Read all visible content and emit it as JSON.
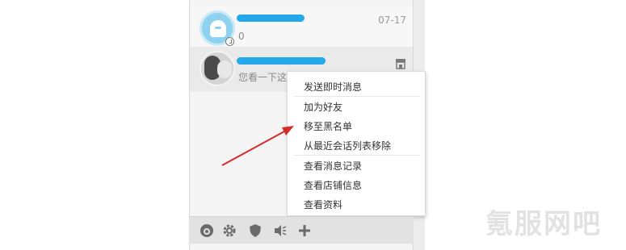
{
  "conversations": [
    {
      "time": "07-17",
      "preview": "0"
    },
    {
      "preview": "您看一下这…"
    }
  ],
  "context_menu": {
    "items": [
      "发送即时消息",
      "加为好友",
      "移至黑名单",
      "从最近会话列表移除",
      "查看消息记录",
      "查看店铺信息",
      "查看资料"
    ]
  },
  "toolbar_icons": [
    "logo-icon",
    "gear-icon",
    "shield-icon",
    "speaker-icon",
    "plus-icon"
  ],
  "watermark": "氪服网吧",
  "colors": {
    "name_blur": "#23a9e9",
    "arrow": "#d42b2b"
  }
}
